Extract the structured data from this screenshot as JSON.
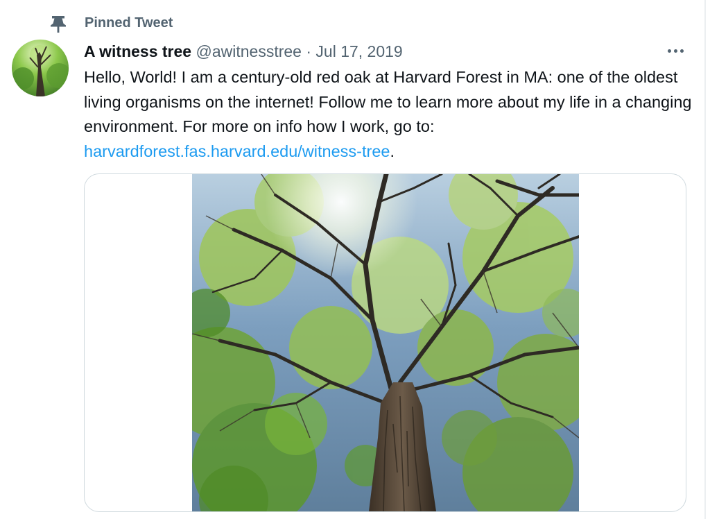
{
  "pinned": {
    "label": "Pinned Tweet",
    "icon": "pin-icon"
  },
  "tweet": {
    "display_name": "A witness tree",
    "handle": "@awitnesstree",
    "separator": "·",
    "date": "Jul 17, 2019",
    "text_before_link": "Hello, World! I am a century-old red oak at Harvard Forest in MA: one of the oldest living organisms on the internet! Follow me to learn more about my life in a changing environment. For more on info how I work, go to: ",
    "link_text": "harvardforest.fas.harvard.edu/witness-tree",
    "text_after_link": ".",
    "more_icon": "more-horizontal-icon"
  },
  "colors": {
    "text_primary": "#0f1419",
    "text_secondary": "#536471",
    "link": "#1d9bf0",
    "card_border": "#cfd9de"
  }
}
